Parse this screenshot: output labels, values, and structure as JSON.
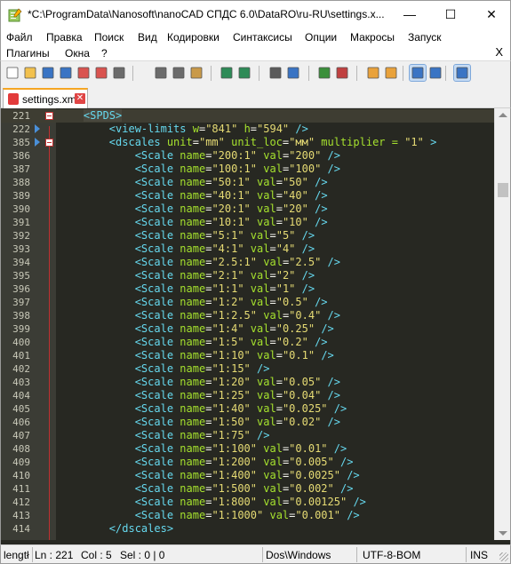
{
  "window": {
    "title": "*C:\\ProgramData\\Nanosoft\\nanoCAD СПДС 6.0\\DataRO\\ru-RU\\settings.x...",
    "minimize": "—",
    "maximize": "☐",
    "close": "✕"
  },
  "menu": {
    "row1": [
      "Файл",
      "Правка",
      "Поиск",
      "Вид",
      "Кодировки",
      "Синтаксисы",
      "Опции",
      "Макросы",
      "Запуск"
    ],
    "row2": [
      "Плагины",
      "Окна",
      "?"
    ],
    "close_doc": "X"
  },
  "toolbar": {
    "icons": [
      "new-file-icon",
      "open-file-icon",
      "save-icon",
      "save-all-icon",
      "close-icon",
      "close-all-icon",
      "print-icon",
      "cut-icon",
      "copy-icon",
      "paste-icon",
      "undo-icon",
      "redo-icon",
      "find-icon",
      "replace-icon",
      "zoom-in-icon",
      "zoom-out-icon",
      "sync-vertical-icon",
      "sync-horizontal-icon",
      "word-wrap-icon",
      "show-all-chars-icon",
      "indent-guide-icon"
    ]
  },
  "tab": {
    "label": "settings.xml",
    "close": "✕"
  },
  "editor": {
    "colors": {
      "background": "#272822",
      "tag": "#66d9ef",
      "attribute": "#a6e22e",
      "string": "#e6db74",
      "text": "#f8f8f2",
      "gutter": "#3b3c35"
    },
    "lines": [
      {
        "n": "221",
        "indent": "    ",
        "tag": "<SPDS>",
        "attrs": [],
        "close": "",
        "fold": true,
        "current": true,
        "bookmark": false
      },
      {
        "n": "222",
        "indent": "        ",
        "tag": "<view-limits",
        "attrs": [
          [
            "w",
            "\"841\""
          ],
          [
            "h",
            "\"594\""
          ]
        ],
        "close": "/>",
        "fold": false,
        "current": false,
        "bookmark": true
      },
      {
        "n": "385",
        "indent": "        ",
        "tag": "<dscales",
        "attrs": [
          [
            "unit",
            "\"mm\""
          ],
          [
            "unit_loc",
            "\"мм\""
          ],
          [
            "multiplier = ",
            "\"1\""
          ]
        ],
        "close": ">",
        "fold": true,
        "current": false,
        "bookmark": true
      },
      {
        "n": "386",
        "indent": "            ",
        "tag": "<Scale",
        "attrs": [
          [
            "name",
            "\"200:1\""
          ],
          [
            "val",
            "\"200\""
          ]
        ],
        "close": "/>"
      },
      {
        "n": "387",
        "indent": "            ",
        "tag": "<Scale",
        "attrs": [
          [
            "name",
            "\"100:1\""
          ],
          [
            "val",
            "\"100\""
          ]
        ],
        "close": "/>"
      },
      {
        "n": "388",
        "indent": "            ",
        "tag": "<Scale",
        "attrs": [
          [
            "name",
            "\"50:1\""
          ],
          [
            "val",
            "\"50\""
          ]
        ],
        "close": "/>"
      },
      {
        "n": "389",
        "indent": "            ",
        "tag": "<Scale",
        "attrs": [
          [
            "name",
            "\"40:1\""
          ],
          [
            "val",
            "\"40\""
          ]
        ],
        "close": "/>"
      },
      {
        "n": "390",
        "indent": "            ",
        "tag": "<Scale",
        "attrs": [
          [
            "name",
            "\"20:1\""
          ],
          [
            "val",
            "\"20\""
          ]
        ],
        "close": "/>"
      },
      {
        "n": "391",
        "indent": "            ",
        "tag": "<Scale",
        "attrs": [
          [
            "name",
            "\"10:1\""
          ],
          [
            "val",
            "\"10\""
          ]
        ],
        "close": "/>"
      },
      {
        "n": "392",
        "indent": "            ",
        "tag": "<Scale",
        "attrs": [
          [
            "name",
            "\"5:1\""
          ],
          [
            "val",
            "\"5\""
          ]
        ],
        "close": "/>"
      },
      {
        "n": "393",
        "indent": "            ",
        "tag": "<Scale",
        "attrs": [
          [
            "name",
            "\"4:1\""
          ],
          [
            "val",
            "\"4\""
          ]
        ],
        "close": "/>"
      },
      {
        "n": "394",
        "indent": "            ",
        "tag": "<Scale",
        "attrs": [
          [
            "name",
            "\"2.5:1\""
          ],
          [
            "val",
            "\"2.5\""
          ]
        ],
        "close": "/>"
      },
      {
        "n": "395",
        "indent": "            ",
        "tag": "<Scale",
        "attrs": [
          [
            "name",
            "\"2:1\""
          ],
          [
            "val",
            "\"2\""
          ]
        ],
        "close": "/>"
      },
      {
        "n": "396",
        "indent": "            ",
        "tag": "<Scale",
        "attrs": [
          [
            "name",
            "\"1:1\""
          ],
          [
            "val",
            "\"1\""
          ]
        ],
        "close": "/>"
      },
      {
        "n": "397",
        "indent": "            ",
        "tag": "<Scale",
        "attrs": [
          [
            "name",
            "\"1:2\""
          ],
          [
            "val",
            "\"0.5\""
          ]
        ],
        "close": "/>"
      },
      {
        "n": "398",
        "indent": "            ",
        "tag": "<Scale",
        "attrs": [
          [
            "name",
            "\"1:2.5\""
          ],
          [
            "val",
            "\"0.4\""
          ]
        ],
        "close": "/>"
      },
      {
        "n": "399",
        "indent": "            ",
        "tag": "<Scale",
        "attrs": [
          [
            "name",
            "\"1:4\""
          ],
          [
            "val",
            "\"0.25\""
          ]
        ],
        "close": "/>"
      },
      {
        "n": "400",
        "indent": "            ",
        "tag": "<Scale",
        "attrs": [
          [
            "name",
            "\"1:5\""
          ],
          [
            "val",
            "\"0.2\""
          ]
        ],
        "close": "/>"
      },
      {
        "n": "401",
        "indent": "            ",
        "tag": "<Scale",
        "attrs": [
          [
            "name",
            "\"1:10\""
          ],
          [
            "val",
            "\"0.1\""
          ]
        ],
        "close": "/>"
      },
      {
        "n": "402",
        "indent": "            ",
        "tag": "<Scale",
        "attrs": [
          [
            "name",
            "\"1:15\""
          ]
        ],
        "close": "/>"
      },
      {
        "n": "403",
        "indent": "            ",
        "tag": "<Scale",
        "attrs": [
          [
            "name",
            "\"1:20\""
          ],
          [
            "val",
            "\"0.05\""
          ]
        ],
        "close": "/>"
      },
      {
        "n": "404",
        "indent": "            ",
        "tag": "<Scale",
        "attrs": [
          [
            "name",
            "\"1:25\""
          ],
          [
            "val",
            "\"0.04\""
          ]
        ],
        "close": "/>"
      },
      {
        "n": "405",
        "indent": "            ",
        "tag": "<Scale",
        "attrs": [
          [
            "name",
            "\"1:40\""
          ],
          [
            "val",
            "\"0.025\""
          ]
        ],
        "close": "/>"
      },
      {
        "n": "406",
        "indent": "            ",
        "tag": "<Scale",
        "attrs": [
          [
            "name",
            "\"1:50\""
          ],
          [
            "val",
            "\"0.02\""
          ]
        ],
        "close": "/>"
      },
      {
        "n": "407",
        "indent": "            ",
        "tag": "<Scale",
        "attrs": [
          [
            "name",
            "\"1:75\""
          ]
        ],
        "close": "/>"
      },
      {
        "n": "408",
        "indent": "            ",
        "tag": "<Scale",
        "attrs": [
          [
            "name",
            "\"1:100\""
          ],
          [
            "val",
            "\"0.01\""
          ]
        ],
        "close": "/>"
      },
      {
        "n": "409",
        "indent": "            ",
        "tag": "<Scale",
        "attrs": [
          [
            "name",
            "\"1:200\""
          ],
          [
            "val",
            "\"0.005\""
          ]
        ],
        "close": "/>"
      },
      {
        "n": "410",
        "indent": "            ",
        "tag": "<Scale",
        "attrs": [
          [
            "name",
            "\"1:400\""
          ],
          [
            "val",
            "\"0.0025\""
          ]
        ],
        "close": "/>"
      },
      {
        "n": "411",
        "indent": "            ",
        "tag": "<Scale",
        "attrs": [
          [
            "name",
            "\"1:500\""
          ],
          [
            "val",
            "\"0.002\""
          ]
        ],
        "close": "/>"
      },
      {
        "n": "412",
        "indent": "            ",
        "tag": "<Scale",
        "attrs": [
          [
            "name",
            "\"1:800\""
          ],
          [
            "val",
            "\"0.00125\""
          ]
        ],
        "close": "/>"
      },
      {
        "n": "413",
        "indent": "            ",
        "tag": "<Scale",
        "attrs": [
          [
            "name",
            "\"1:1000\""
          ],
          [
            "val",
            "\"0.001\""
          ]
        ],
        "close": "/>"
      },
      {
        "n": "414",
        "indent": "        ",
        "tag": "</dscales>",
        "attrs": [],
        "close": ""
      }
    ]
  },
  "status": {
    "length": "lengtł",
    "ln": "Ln : 221",
    "col": "Col : 5",
    "sel": "Sel : 0 | 0",
    "eol": "Dos\\Windows",
    "encoding": "UTF-8-BOM",
    "mode": "INS"
  }
}
